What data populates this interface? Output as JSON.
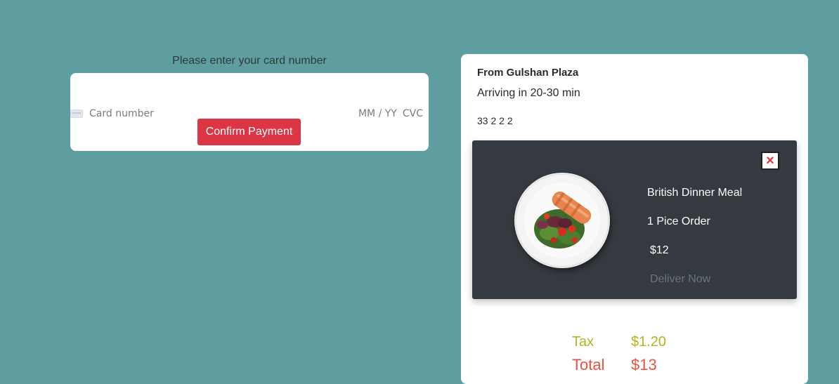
{
  "payment": {
    "title": "Please enter your card number",
    "card_number_placeholder": "Card number",
    "expiry_placeholder": "MM / YY",
    "cvc_placeholder": "CVC",
    "confirm_label": "Confirm Payment"
  },
  "order": {
    "from": "From Gulshan Plaza",
    "arriving": "Arriving in 20-30 min",
    "address": "33 2 2 2",
    "item": {
      "close_label": "×",
      "name": "British Dinner Meal",
      "quantity": "1 Pice Order",
      "price": "$12",
      "deliver_label": "Deliver Now",
      "image_icon": "salmon-salad-plate"
    },
    "tax_label": "Tax",
    "tax_value": "$1.20",
    "total_label": "Total",
    "total_value": "$13"
  },
  "colors": {
    "background": "#5f9ea0",
    "confirm_button": "#dc3545",
    "panel": "#343a40",
    "tax": "#b4b41f",
    "total": "#e8533f"
  }
}
